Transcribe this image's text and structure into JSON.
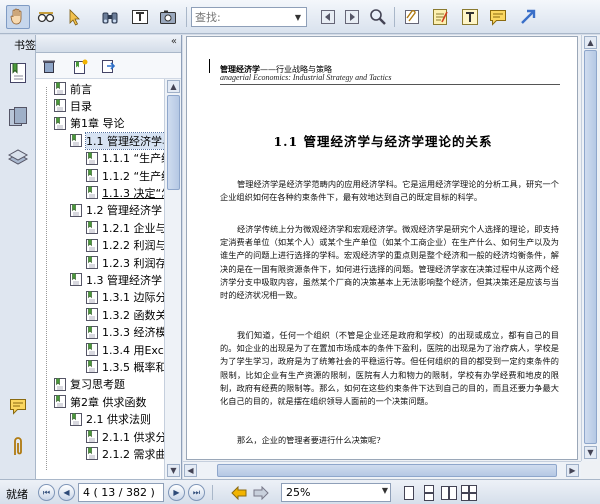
{
  "toolbar": {
    "search_placeholder": "查找:",
    "icons": [
      "hand-icon",
      "reading-glasses-icon",
      "select-arrow-icon",
      "binoculars-icon",
      "text-select-icon",
      "snapshot-icon",
      "search-prev-icon",
      "search-next-icon",
      "search-result-icon",
      "attach-icon",
      "note-icon",
      "text-box-icon",
      "comment-icon",
      "arrow-tool-icon"
    ]
  },
  "sidebar": {
    "title": "书签",
    "collapse": "«",
    "tabs": [
      "bookmarks-icon",
      "pages-icon",
      "layers-icon",
      "comments-icon",
      "attachments-icon"
    ]
  },
  "bookmarks": [
    {
      "label": "前言",
      "level": 0
    },
    {
      "label": "目录",
      "level": 0
    },
    {
      "label": "第1章  导论",
      "level": 0
    },
    {
      "label": "1.1  管理经济学与",
      "level": 1,
      "selected": true
    },
    {
      "label": "1.1.1  “生产经",
      "level": 2
    },
    {
      "label": "1.1.2  “生产经",
      "level": 2
    },
    {
      "label": "1.1.3  决定“怎",
      "level": 2,
      "underline": true
    },
    {
      "label": "1.2  管理经济学",
      "level": 1
    },
    {
      "label": "1.2.1  企业与企",
      "level": 2
    },
    {
      "label": "1.2.2  利润与利",
      "level": 2
    },
    {
      "label": "1.2.3  利润存在",
      "level": 2
    },
    {
      "label": "1.3  管理经济学",
      "level": 1
    },
    {
      "label": "1.3.1  边际分析",
      "level": 2
    },
    {
      "label": "1.3.2  函数关系",
      "level": 2
    },
    {
      "label": "1.3.3  经济模型",
      "level": 2
    },
    {
      "label": "1.3.4  用Excel",
      "level": 2
    },
    {
      "label": "1.3.5  概率和时",
      "level": 2
    },
    {
      "label": "复习思考题",
      "level": 0
    },
    {
      "label": "第2章  供求函数",
      "level": 0
    },
    {
      "label": "2.1  供求法则",
      "level": 1
    },
    {
      "label": "2.1.1  供求分析",
      "level": 2
    },
    {
      "label": "2.1.2  需求曲线",
      "level": 2
    }
  ],
  "document": {
    "header_title": "管理经济学",
    "header_title_rest": "——行业战略与策略",
    "header_subtitle": "anagerial Economics: Industrial Strategy and Tactics",
    "section_heading": "1.1    管理经济学与经济学理论的关系",
    "paragraphs": [
      "管理经济学是经济学范畴内的应用经济学科。它是运用经济学理论的分析工具，研究一个企业组织如何在各种约束条件下，最有效地达到自己的既定目标的科学。",
      "经济学传统上分为微观经济学和宏观经济学。微观经济学是研究个人选择的理论，即支持定消费者单位（如某个人）或某个生产单位（如某个工商企业）在生产什么、如何生产以及为谁生产的问题上进行选择的学科。宏观经济学的重点则是整个经济和一般的经济均衡条件，解决的是在一国有限资源条件下，如何进行选择的问题。管理经济学家在决策过程中从这两个经济学分支中吸取内容，虽然某个厂商的决策基本上无法影响整个经济，但其决策还是应该与当时的经济状况相一致。",
      "我们知道，任何一个组织（不管是企业还是政府和学校）的出现或成立，都有自己的目的。如企业的出现是为了在置加市场成本的条件下盈利，医院的出现是为了治疗病人，学校是为了学生学习，政府是为了统筹社会的平稳运行等。但任何组织的目的都受到一定约束条件的限制，比如企业有生产资源的限制，医院有人力和物力的限制，学校有办学经费和地皮的限制，政府有经费的限制等。那么，如何在这些约束条件下达到自己的目的，而且还要力争最大化自己的目的，就是摆在组织领导人面前的一个决策问题。",
      "那么，企业的管理者要进行什么决策呢?"
    ]
  },
  "status": {
    "text": "就绪",
    "page_field": "4 ( 13 / 382 )",
    "zoom": "25%"
  },
  "colors": {
    "accent": "#7f9bc4",
    "panel_bg": "#d4dce8",
    "selection": "#d7e3f3"
  }
}
